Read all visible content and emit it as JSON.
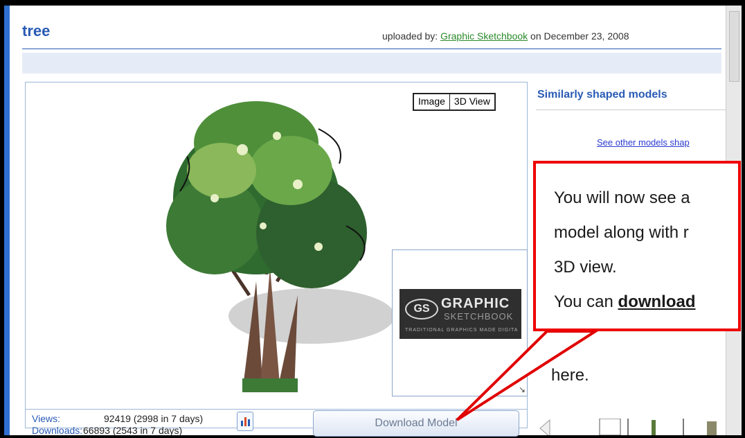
{
  "model": {
    "title": "tree",
    "uploaded_prefix": "uploaded by:",
    "uploader": "Graphic Sketchbook",
    "uploaded_suffix": "on December 23, 2008"
  },
  "view_toggle": {
    "image_label": "Image",
    "view3d_label": "3D View"
  },
  "logo": {
    "gs": "GS",
    "line1": "GRAPHIC",
    "line2": "SKETCHBOOK",
    "line3": "TRADITIONAL GRAPHICS MADE DIGITA"
  },
  "stats": {
    "views_label": "Views:",
    "views_value": "92419 (2998 in 7 days)",
    "downloads_label": "Downloads:",
    "downloads_value": "66893 (2543 in 7 days)"
  },
  "download_button": "Download Model",
  "sidebar": {
    "heading": "Similarly shaped models",
    "see_other": "See other models shap"
  },
  "callout": {
    "line1": "You will now see a",
    "line2": "model along with r",
    "line3": "3D view.",
    "line4_prefix": "You can ",
    "line4_bold": "download",
    "line5": "here."
  },
  "colors": {
    "accent": "#2a5bb5",
    "callout_border": "#e00000",
    "link_green": "#2a8a2a"
  }
}
